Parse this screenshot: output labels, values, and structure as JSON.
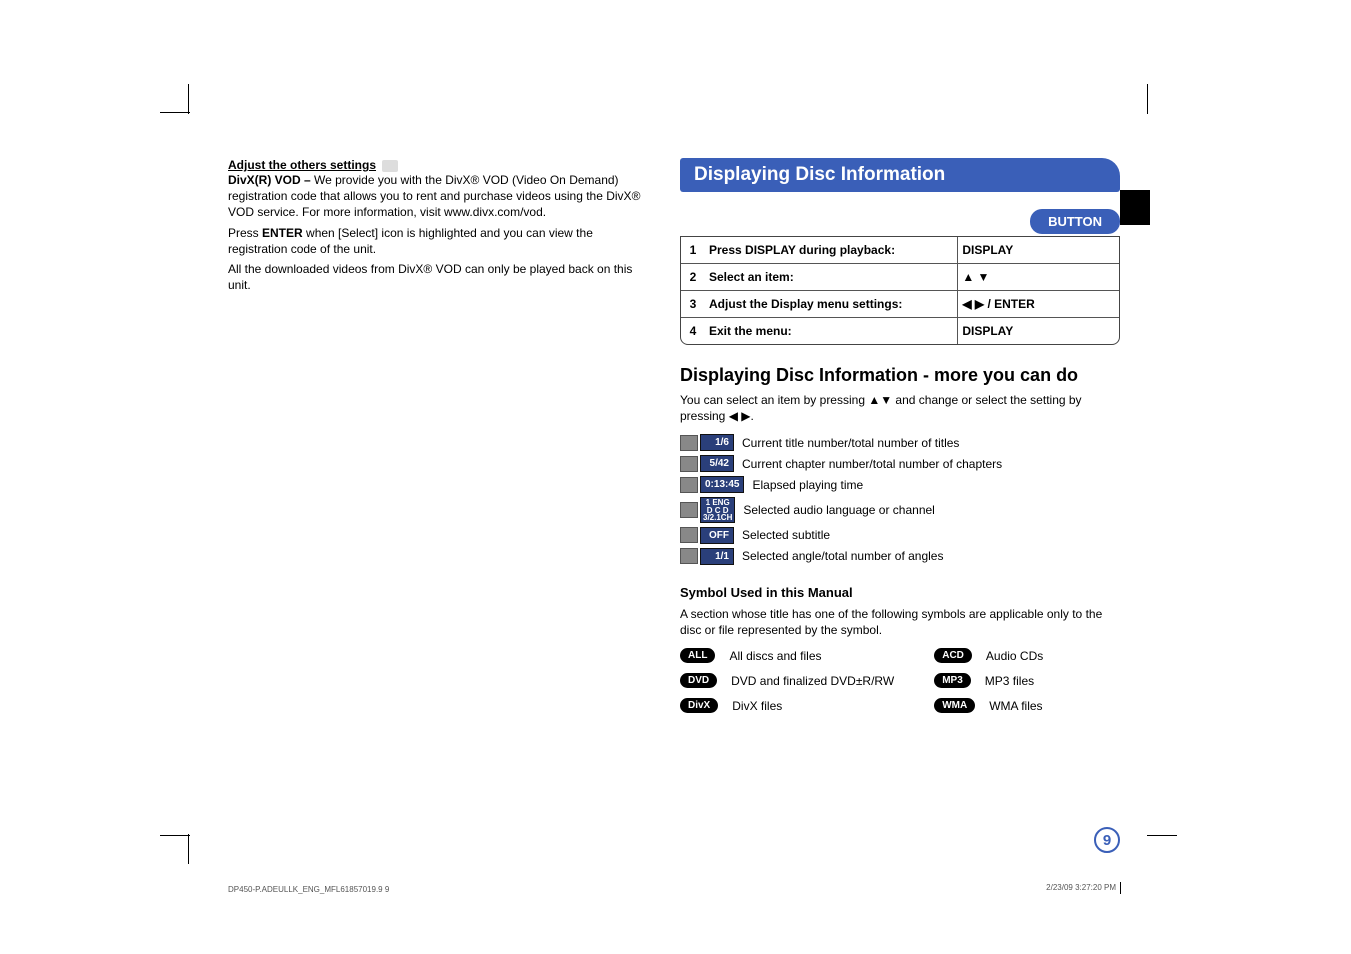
{
  "left": {
    "section_title": "Adjust the others settings",
    "para1": "DivX(R) VOD – We provide you with the DivX® VOD (Video On Demand) registration code that allows you to rent and purchase videos using the DivX® VOD service. For more information, visit www.divx.com/vod.",
    "para2_prefix": "Press ",
    "para2_bold": "ENTER",
    "para2_suffix": " when [Select] icon is highlighted and you can view the registration code of the unit.",
    "para3": "All the downloaded videos from DivX® VOD can only be played back on this unit."
  },
  "right": {
    "header": "Displaying Disc Information",
    "button_label": "BUTTON",
    "steps": [
      {
        "num": "1",
        "desc": "Press DISPLAY during playback:",
        "btn": "DISPLAY"
      },
      {
        "num": "2",
        "desc": "Select an item:",
        "btn": "▲ ▼"
      },
      {
        "num": "3",
        "desc": "Adjust the Display menu settings:",
        "btn": "◀ ▶ / ENTER"
      },
      {
        "num": "4",
        "desc": "Exit the menu:",
        "btn": "DISPLAY"
      }
    ],
    "subheading": "Displaying Disc Information - more you can do",
    "intro": "You can select an item by pressing ▲▼ and change or select the setting by pressing ◀ ▶.",
    "osd": [
      {
        "badge": "1/6",
        "text": "Current title number/total number of titles"
      },
      {
        "badge": "5/42",
        "text": "Current chapter number/total number of chapters"
      },
      {
        "badge": "0:13:45",
        "text": "Elapsed playing time"
      },
      {
        "badge": "1  ENG\nD C D\n3/2.1CH",
        "text": "Selected audio language or channel",
        "audio": true
      },
      {
        "badge": "OFF",
        "text": "Selected subtitle"
      },
      {
        "badge": "1/1",
        "text": "Selected angle/total number of angles"
      }
    ],
    "symbol_heading": "Symbol Used in this Manual",
    "symbol_intro": "A section whose title has one of the following symbols are applicable only to the disc or file represented by the symbol.",
    "symbols_left": [
      {
        "pill": "ALL",
        "label": "All discs and files"
      },
      {
        "pill": "DVD",
        "label": "DVD and finalized DVD±R/RW"
      },
      {
        "pill": "DivX",
        "label": "DivX files"
      }
    ],
    "symbols_right": [
      {
        "pill": "ACD",
        "label": "Audio CDs"
      },
      {
        "pill": "MP3",
        "label": "MP3 files"
      },
      {
        "pill": "WMA",
        "label": "WMA files"
      }
    ]
  },
  "page_number": "9",
  "footer": {
    "left": "DP450-P.ADEULLK_ENG_MFL61857019.9   9",
    "right": "2/23/09   3:27:20 PM"
  }
}
